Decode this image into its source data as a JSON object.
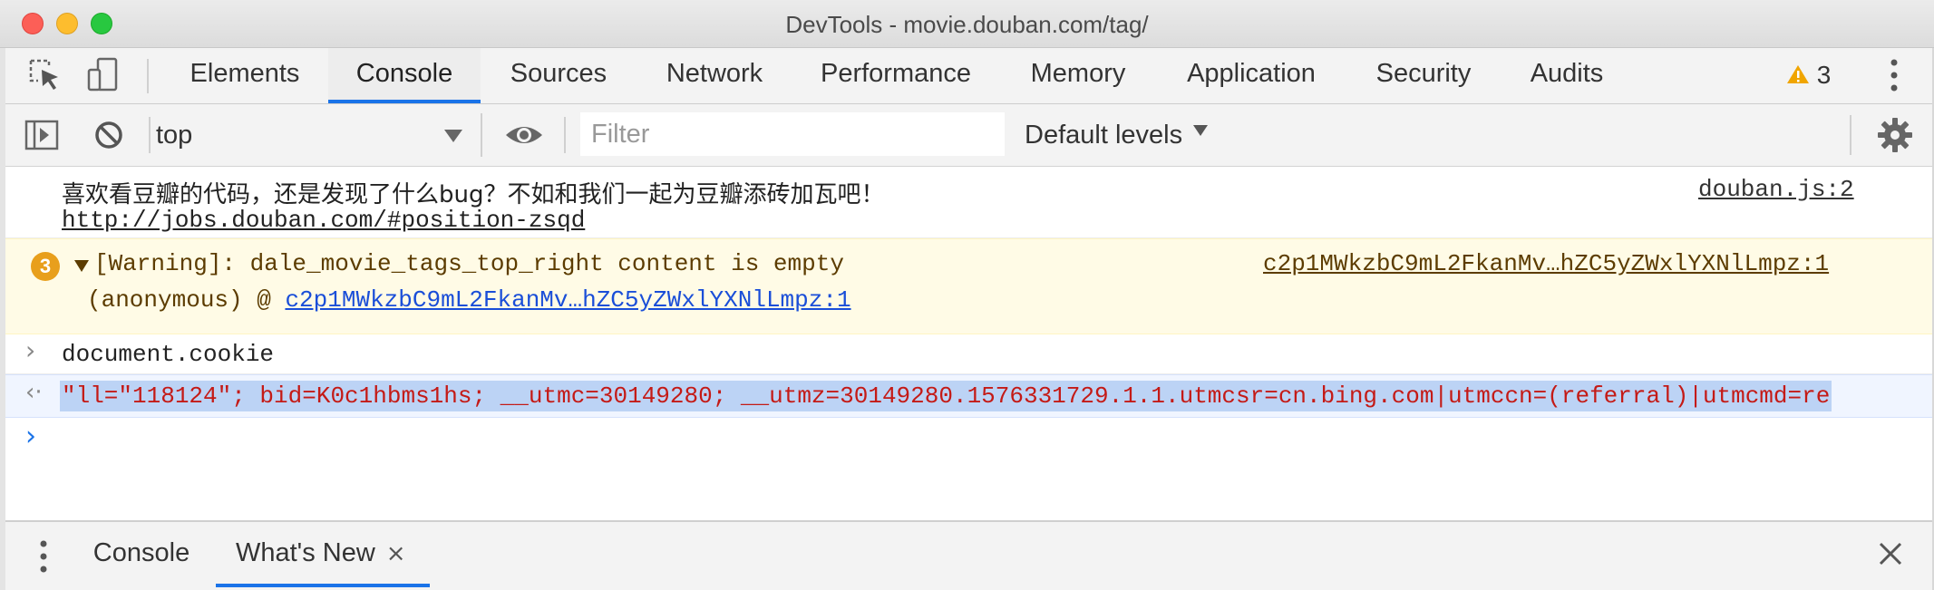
{
  "window": {
    "title": "DevTools - movie.douban.com/tag/"
  },
  "tabs": [
    {
      "label": "Elements"
    },
    {
      "label": "Console",
      "active": true
    },
    {
      "label": "Sources"
    },
    {
      "label": "Network"
    },
    {
      "label": "Performance"
    },
    {
      "label": "Memory"
    },
    {
      "label": "Application"
    },
    {
      "label": "Security"
    },
    {
      "label": "Audits"
    }
  ],
  "warnings": {
    "count": "3"
  },
  "console_toolbar": {
    "context": "top",
    "filter_placeholder": "Filter",
    "levels": "Default levels"
  },
  "messages": {
    "log": {
      "text": "喜欢看豆瓣的代码，还是发现了什么bug？不如和我们一起为豆瓣添砖加瓦吧！",
      "link": "http://jobs.douban.com/#position-zsqd",
      "source": "douban.js:2"
    },
    "warning": {
      "count": "3",
      "text": "[Warning]: dale_movie_tags_top_right content is empty",
      "source": "c2p1MWkzbC9mL2FkanMv…hZC5yZWxlYXNlLmpz:1",
      "stack_prefix": "(anonymous) @",
      "stack_link": "c2p1MWkzbC9mL2FkanMv…hZC5yZWxlYXNlLmpz:1"
    },
    "command": "document.cookie",
    "result": "\"ll=\"118124\"; bid=K0c1hbms1hs; __utmc=30149280; __utmz=30149280.1576331729.1.1.utmcsr=cn.bing.com|utmccn=(referral)|utmcmd=re"
  },
  "drawer": {
    "tabs": [
      {
        "label": "Console"
      },
      {
        "label": "What's New",
        "active": true,
        "close": "×"
      }
    ]
  },
  "colors": {
    "accent": "#1a73e8",
    "warning_bg": "#fffbe6",
    "warning_text": "#5c3c00",
    "result_text": "#c41a16"
  }
}
